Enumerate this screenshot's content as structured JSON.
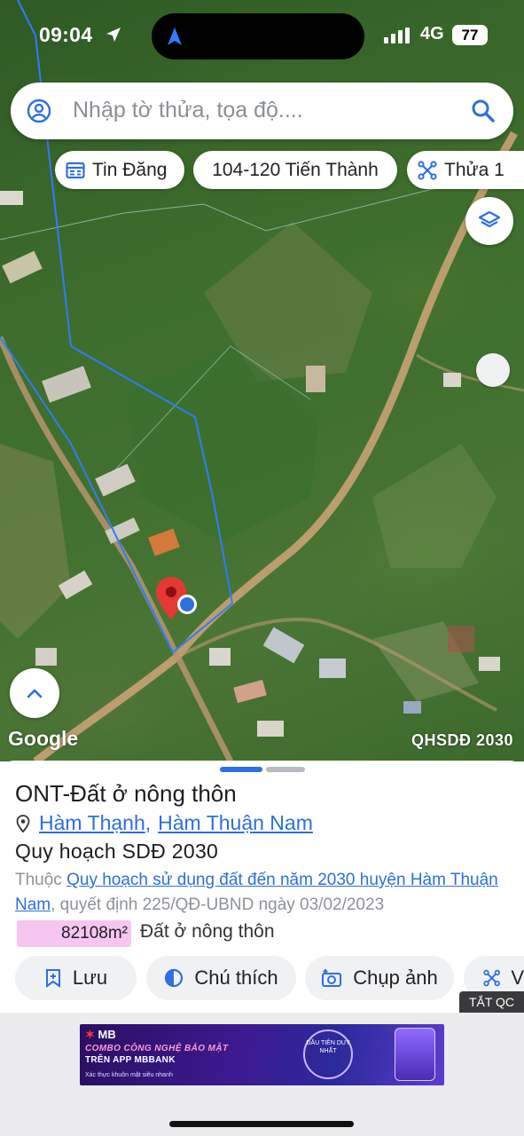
{
  "status_bar": {
    "time": "09:04",
    "network": "4G",
    "battery": "77"
  },
  "search": {
    "placeholder": "Nhập tờ thửa, tọa độ...."
  },
  "chips": {
    "tin_dang": "Tin Đăng",
    "range": "104-120 Tiến Thành",
    "thua": "Thửa 1"
  },
  "map": {
    "attribution": "Google",
    "layer_label": "QHSDĐ 2030",
    "parcel_color": "#2f7cff",
    "pin_color": "#e53935"
  },
  "parcel": {
    "title": "ONT-Đất ở nông thôn",
    "commune": "Hàm Thạnh",
    "district": "Hàm Thuận Nam",
    "plan_title": "Quy hoạch SDĐ 2030",
    "desc_prefix": "Thuộc ",
    "plan_link": "Quy hoạch sử dụng đất đến năm 2030 huyện Hàm Thuận Nam",
    "desc_suffix": ", quyết định 225/QĐ-UBND ngày 03/02/2023",
    "area_value": "82108m²",
    "area_badge_color": "#f6c6f0",
    "area_label": "Đất ở nông thôn"
  },
  "actions": {
    "save": "Lưu",
    "legend": "Chú thích",
    "capture": "Chụp ảnh",
    "more": "V"
  },
  "ads": {
    "close_label": "TẮT QC",
    "brand": "MB",
    "line1": "COMBO CÔNG NGHỆ BẢO MẬT",
    "line2": "TRÊN APP MBBANK",
    "line3": "Xác thực khuôn mặt siêu nhanh",
    "seal": "ĐẦU TIÊN DUY NHẤT"
  }
}
